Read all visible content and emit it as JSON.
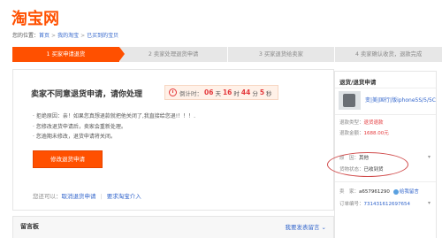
{
  "logo": "淘宝网",
  "breadcrumb": {
    "prefix": "您的位置：",
    "items": [
      "首页",
      "我的淘宝",
      "已买到的宝贝"
    ]
  },
  "steps": [
    {
      "label": "1  买家申请退货",
      "active": true
    },
    {
      "label": "2  卖家处理退货申请",
      "active": false
    },
    {
      "label": "3  买家退货给卖家",
      "active": false
    },
    {
      "label": "4  卖家确认收货，退款完成",
      "active": false
    }
  ],
  "main": {
    "title": "卖家不同意退货申请，请你处理",
    "timer": {
      "label": "倒计时：",
      "days": "06",
      "days_unit": "天",
      "hours": "16",
      "hours_unit": "时",
      "minutes": "44",
      "minutes_unit": "分",
      "seconds": "5",
      "seconds_unit": "秒"
    },
    "info_lines": [
      "· 拒绝原因：亲！如果您真想退款就把他关闭了,我直接给您退!！！！.",
      "· 您修改退货申请后，卖家会重新处理。",
      "· 您逾期未修改，退货申请将关闭。"
    ],
    "modify_button": "修改退货申请",
    "alt_actions": {
      "prefix": "您还可以：",
      "cancel": "取消退货申请",
      "complain": "要求淘宝介入"
    }
  },
  "message_board": {
    "title": "留言板",
    "action": "我要发表留言"
  },
  "panel": {
    "title": "退货/退货申请",
    "product_name": "变|美|国行|版iphone5S/5/5C",
    "refund_type_label": "退款类型：",
    "refund_type": "退货退款",
    "amount_label": "退款金额：",
    "amount": "1688.00元",
    "reason_label": "原　因：",
    "reason": "其他",
    "status_label": "货物状态：",
    "status": "已收到货",
    "seller_label": "卖　家：",
    "seller": "a657961290",
    "contact": "给我留言",
    "order_label": "订单编号：",
    "order_no": "731431612697654"
  }
}
